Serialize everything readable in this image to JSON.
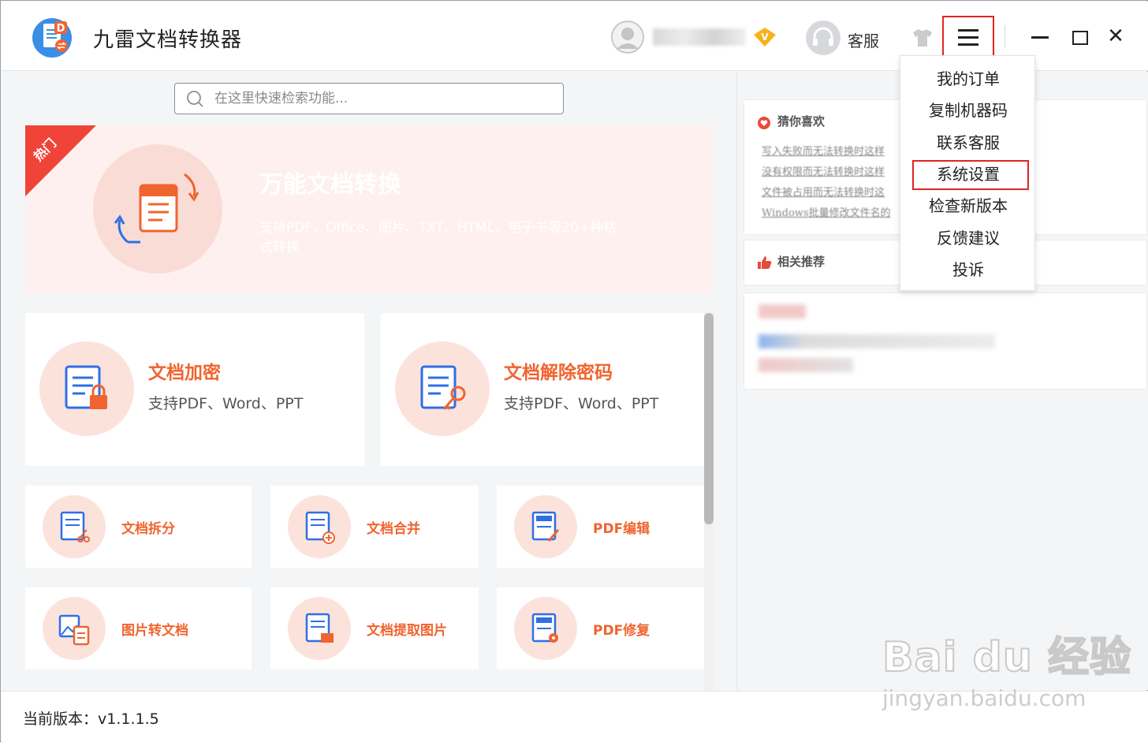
{
  "titlebar": {
    "app_title": "九雷文档转换器",
    "service_label": "客服",
    "close_glyph": "✕"
  },
  "search": {
    "placeholder": "在这里快速检索功能..."
  },
  "hero": {
    "ribbon": "热门",
    "title": "万能文档转换",
    "desc": "支持PDF、Office、图片、TXT、HTML、电子书等20+种格式转换"
  },
  "features_large": [
    {
      "title": "文档加密",
      "desc": "支持PDF、Word、PPT",
      "icon": "lock-document-icon"
    },
    {
      "title": "文档解除密码",
      "desc": "支持PDF、Word、PPT",
      "icon": "key-document-icon"
    }
  ],
  "features_small": [
    {
      "title": "文档拆分",
      "icon": "split-document-icon"
    },
    {
      "title": "文档合并",
      "icon": "merge-document-icon"
    },
    {
      "title": "PDF编辑",
      "icon": "pdf-edit-icon"
    },
    {
      "title": "图片转文档",
      "icon": "image-to-document-icon"
    },
    {
      "title": "文档提取图片",
      "icon": "extract-image-icon"
    },
    {
      "title": "PDF修复",
      "icon": "pdf-repair-icon"
    }
  ],
  "sidebar": {
    "guess_title": "猜你喜欢",
    "guess_links": [
      "写入失败而无法转换时这样",
      "没有权限而无法转换时这样",
      "文件被占用而无法转换时这",
      "Windows批量修改文件名的"
    ],
    "related_title": "相关推荐"
  },
  "dropdown": {
    "items": [
      "我的订单",
      "复制机器码",
      "联系客服",
      "系统设置",
      "检查新版本",
      "反馈建议",
      "投诉"
    ]
  },
  "status": {
    "version": "当前版本：v1.1.1.5"
  },
  "watermark": {
    "logo": "Bai du 经验",
    "url": "jingyan.baidu.com"
  },
  "colors": {
    "accent": "#f0642f",
    "highlight_red": "#e02424",
    "hero_bg": "#fef0ee",
    "icon_circle": "#fbe3dc"
  }
}
